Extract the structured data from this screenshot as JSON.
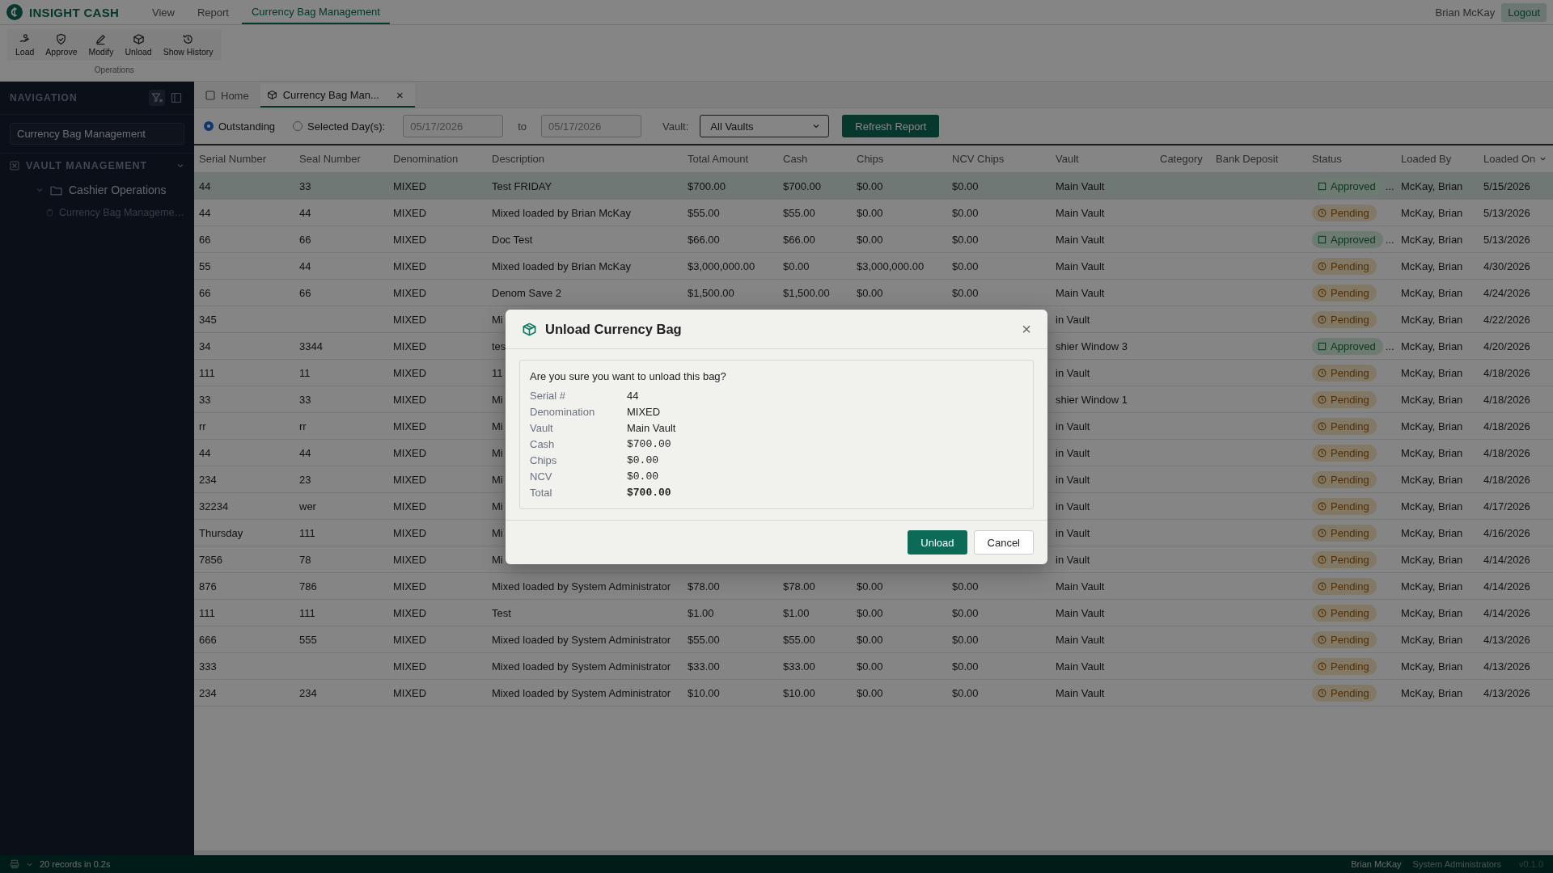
{
  "app": {
    "name": "INSIGHT CASH",
    "menu": [
      {
        "label": "View",
        "selected": false
      },
      {
        "label": "Report",
        "selected": false
      },
      {
        "label": "Currency Bag Management",
        "selected": true
      }
    ],
    "user": "Brian McKay",
    "logout": "Logout"
  },
  "toolbar": {
    "buttons": [
      {
        "kind": "load",
        "label": "Load"
      },
      {
        "kind": "approve",
        "label": "Approve"
      },
      {
        "kind": "modify",
        "label": "Modify"
      },
      {
        "kind": "unload",
        "label": "Unload"
      },
      {
        "kind": "history",
        "label": "Show History"
      }
    ],
    "group": "Operations"
  },
  "sidebar": {
    "title": "NAVIGATION",
    "search": "Currency Bag Management",
    "tree": [
      {
        "label": "VAULT MANAGEMENT",
        "expanded": true,
        "children": [
          {
            "label": "Cashier Operations",
            "expanded": true,
            "children": [
              {
                "label": "Currency Bag Manageme…"
              }
            ]
          }
        ]
      }
    ]
  },
  "tabs": [
    {
      "label": "Home",
      "selected": false
    },
    {
      "label": "Currency Bag Man...",
      "selected": true,
      "close": "×"
    }
  ],
  "filters": {
    "modes": [
      {
        "label": "Outstanding",
        "selected": true
      },
      {
        "label": "Selected Day(s):",
        "selected": false
      }
    ],
    "from": "05/17/2026",
    "to_label": "to",
    "to": "05/17/2026",
    "vault_label": "Vault:",
    "vault": "All Vaults",
    "refresh": "Refresh Report"
  },
  "table": {
    "columns": [
      {
        "label": "Serial Number",
        "sorted": false
      },
      {
        "label": "Seal Number",
        "sorted": false
      },
      {
        "label": "Denomination",
        "sorted": false
      },
      {
        "label": "Description",
        "sorted": false
      },
      {
        "label": "Total Amount",
        "sorted": false
      },
      {
        "label": "Cash",
        "sorted": false
      },
      {
        "label": "Chips",
        "sorted": false
      },
      {
        "label": "NCV Chips",
        "sorted": false
      },
      {
        "label": "Vault",
        "sorted": false
      },
      {
        "label": "Category",
        "sorted": false
      },
      {
        "label": "Bank Deposit",
        "sorted": false
      },
      {
        "label": "Status",
        "sorted": false
      },
      {
        "label": "Loaded By",
        "sorted": false
      },
      {
        "label": "Loaded On",
        "sorted": true
      }
    ],
    "rows": [
      {
        "selected": true,
        "serial": "44",
        "seal": "33",
        "denomination": "MIXED",
        "description": "Test FRIDAY",
        "total": "$700.00",
        "cash": "$700.00",
        "chips": "$0.00",
        "ncv": "$0.00",
        "vault": "Main Vault",
        "status": {
          "kind": "approved",
          "label": "Approved"
        },
        "more": "...",
        "loaded_by": "McKay, Brian",
        "loaded_on": "5/15/2026"
      },
      {
        "selected": false,
        "serial": "44",
        "seal": "44",
        "denomination": "MIXED",
        "description": "Mixed loaded by Brian McKay",
        "total": "$55.00",
        "cash": "$55.00",
        "chips": "$0.00",
        "ncv": "$0.00",
        "vault": "Main Vault",
        "status": {
          "kind": "pending",
          "label": "Pending"
        },
        "loaded_by": "McKay, Brian",
        "loaded_on": "5/13/2026"
      },
      {
        "selected": false,
        "serial": "66",
        "seal": "66",
        "denomination": "MIXED",
        "description": "Doc Test",
        "total": "$66.00",
        "cash": "$66.00",
        "chips": "$0.00",
        "ncv": "$0.00",
        "vault": "Main Vault",
        "status": {
          "kind": "approved",
          "label": "Approved"
        },
        "more": "...",
        "loaded_by": "McKay, Brian",
        "loaded_on": "5/13/2026"
      },
      {
        "selected": false,
        "serial": "55",
        "seal": "44",
        "denomination": "MIXED",
        "description": "Mixed loaded by Brian McKay",
        "total": "$3,000,000.00",
        "cash": "$0.00",
        "chips": "$3,000,000.00",
        "ncv": "$0.00",
        "vault": "Main Vault",
        "status": {
          "kind": "pending",
          "label": "Pending"
        },
        "loaded_by": "McKay, Brian",
        "loaded_on": "4/30/2026"
      },
      {
        "selected": false,
        "serial": "66",
        "seal": "66",
        "denomination": "MIXED",
        "description": "Denom Save 2",
        "total": "$1,500.00",
        "cash": "$1,500.00",
        "chips": "$0.00",
        "ncv": "$0.00",
        "vault": "Main Vault",
        "status": {
          "kind": "pending",
          "label": "Pending"
        },
        "loaded_by": "McKay, Brian",
        "loaded_on": "4/24/2026"
      },
      {
        "selected": false,
        "serial": "345",
        "denomination": "MIXED",
        "description": "Mi",
        "vault": "in Vault",
        "status": {
          "kind": "pending",
          "label": "Pending"
        },
        "loaded_by": "McKay, Brian",
        "loaded_on": "4/22/2026"
      },
      {
        "selected": false,
        "serial": "34",
        "seal": "3344",
        "denomination": "MIXED",
        "description": "tes",
        "vault": "shier Window 3",
        "status": {
          "kind": "approved",
          "label": "Approved"
        },
        "more": "...",
        "loaded_by": "McKay, Brian",
        "loaded_on": "4/20/2026"
      },
      {
        "selected": false,
        "serial": "111",
        "seal": "11",
        "denomination": "MIXED",
        "description": "11",
        "vault": "in Vault",
        "status": {
          "kind": "pending",
          "label": "Pending"
        },
        "loaded_by": "McKay, Brian",
        "loaded_on": "4/18/2026"
      },
      {
        "selected": false,
        "serial": "33",
        "seal": "33",
        "denomination": "MIXED",
        "description": "Mi",
        "vault": "shier Window 1",
        "status": {
          "kind": "pending",
          "label": "Pending"
        },
        "loaded_by": "McKay, Brian",
        "loaded_on": "4/18/2026"
      },
      {
        "selected": false,
        "serial": "rr",
        "seal": "rr",
        "denomination": "MIXED",
        "description": "Mi",
        "vault": "in Vault",
        "status": {
          "kind": "pending",
          "label": "Pending"
        },
        "loaded_by": "McKay, Brian",
        "loaded_on": "4/18/2026"
      },
      {
        "selected": false,
        "serial": "44",
        "seal": "44",
        "denomination": "MIXED",
        "description": "Mi",
        "vault": "in Vault",
        "status": {
          "kind": "pending",
          "label": "Pending"
        },
        "loaded_by": "McKay, Brian",
        "loaded_on": "4/18/2026"
      },
      {
        "selected": false,
        "serial": "234",
        "seal": "23",
        "denomination": "MIXED",
        "description": "Mi",
        "vault": "in Vault",
        "status": {
          "kind": "pending",
          "label": "Pending"
        },
        "loaded_by": "McKay, Brian",
        "loaded_on": "4/18/2026"
      },
      {
        "selected": false,
        "serial": "32234",
        "seal": "wer",
        "denomination": "MIXED",
        "description": "Mi",
        "vault": "in Vault",
        "status": {
          "kind": "pending",
          "label": "Pending"
        },
        "loaded_by": "McKay, Brian",
        "loaded_on": "4/17/2026"
      },
      {
        "selected": false,
        "serial": "Thursday",
        "seal": "111",
        "denomination": "MIXED",
        "description": "Mi",
        "vault": "in Vault",
        "status": {
          "kind": "pending",
          "label": "Pending"
        },
        "loaded_by": "McKay, Brian",
        "loaded_on": "4/16/2026"
      },
      {
        "selected": false,
        "serial": "7856",
        "seal": "78",
        "denomination": "MIXED",
        "description": "Mi",
        "vault": "in Vault",
        "status": {
          "kind": "pending",
          "label": "Pending"
        },
        "loaded_by": "McKay, Brian",
        "loaded_on": "4/14/2026"
      },
      {
        "selected": false,
        "serial": "876",
        "seal": "786",
        "denomination": "MIXED",
        "description": "Mixed loaded by System Administrator",
        "total": "$78.00",
        "cash": "$78.00",
        "chips": "$0.00",
        "ncv": "$0.00",
        "vault": "Main Vault",
        "status": {
          "kind": "pending",
          "label": "Pending"
        },
        "loaded_by": "McKay, Brian",
        "loaded_on": "4/14/2026"
      },
      {
        "selected": false,
        "serial": "111",
        "seal": "111",
        "denomination": "MIXED",
        "description": "Test",
        "total": "$1.00",
        "cash": "$1.00",
        "chips": "$0.00",
        "ncv": "$0.00",
        "vault": "Main Vault",
        "status": {
          "kind": "pending",
          "label": "Pending"
        },
        "loaded_by": "McKay, Brian",
        "loaded_on": "4/14/2026"
      },
      {
        "selected": false,
        "serial": "666",
        "seal": "555",
        "denomination": "MIXED",
        "description": "Mixed loaded by System Administrator",
        "total": "$55.00",
        "cash": "$55.00",
        "chips": "$0.00",
        "ncv": "$0.00",
        "vault": "Main Vault",
        "status": {
          "kind": "pending",
          "label": "Pending"
        },
        "loaded_by": "McKay, Brian",
        "loaded_on": "4/13/2026"
      },
      {
        "selected": false,
        "serial": "333",
        "denomination": "MIXED",
        "description": "Mixed loaded by System Administrator",
        "total": "$33.00",
        "cash": "$33.00",
        "chips": "$0.00",
        "ncv": "$0.00",
        "vault": "Main Vault",
        "status": {
          "kind": "pending",
          "label": "Pending"
        },
        "loaded_by": "McKay, Brian",
        "loaded_on": "4/13/2026"
      },
      {
        "selected": false,
        "serial": "234",
        "seal": "234",
        "denomination": "MIXED",
        "description": "Mixed loaded by System Administrator",
        "total": "$10.00",
        "cash": "$10.00",
        "chips": "$0.00",
        "ncv": "$0.00",
        "vault": "Main Vault",
        "status": {
          "kind": "pending",
          "label": "Pending"
        },
        "loaded_by": "McKay, Brian",
        "loaded_on": "4/13/2026"
      }
    ]
  },
  "dialog": {
    "title": "Unload Currency Bag",
    "close": "×",
    "question": "Are you sure you want to unload this bag?",
    "details": [
      {
        "label": "Serial #",
        "value": "44",
        "kind": "text"
      },
      {
        "label": "Denomination",
        "value": "MIXED",
        "kind": "text"
      },
      {
        "label": "Vault",
        "value": "Main Vault",
        "kind": "text"
      },
      {
        "label": "Cash",
        "value": "$700.00",
        "kind": "money"
      },
      {
        "label": "Chips",
        "value": "$0.00",
        "kind": "money"
      },
      {
        "label": "NCV",
        "value": "$0.00",
        "kind": "money"
      },
      {
        "label": "Total",
        "value": "$700.00",
        "kind": "total"
      }
    ],
    "buttons": [
      {
        "label": "Unload",
        "kind": "primary"
      },
      {
        "label": "Cancel",
        "kind": "secondary"
      }
    ]
  },
  "status_bar": {
    "records": "20 records in 0.2s",
    "user": "Brian McKay",
    "role": "System Administrators",
    "version": "v0.1.0"
  }
}
